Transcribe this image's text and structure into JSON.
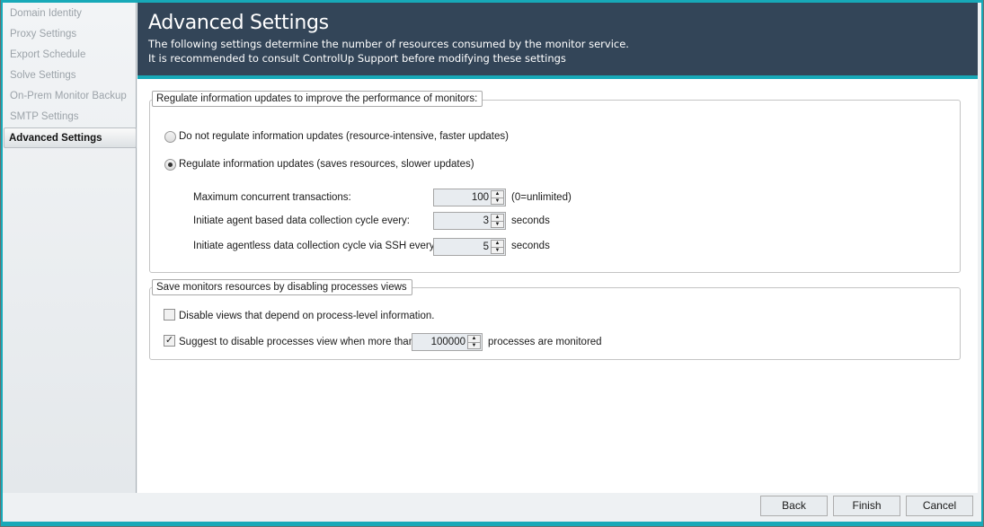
{
  "sidebar": {
    "items": [
      {
        "label": "Domain Identity"
      },
      {
        "label": "Proxy Settings"
      },
      {
        "label": "Export Schedule"
      },
      {
        "label": "Solve Settings"
      },
      {
        "label": "On-Prem Monitor Backup"
      },
      {
        "label": "SMTP Settings"
      },
      {
        "label": "Advanced Settings",
        "active": true
      }
    ]
  },
  "header": {
    "title": "Advanced Settings",
    "line1": "The following settings determine the number of resources consumed by the monitor service.",
    "line2": "It is recommended to consult ControlUp Support before modifying these settings"
  },
  "regulate": {
    "legend": "Regulate information updates to improve the performance of monitors:",
    "option_off": "Do not regulate information updates (resource-intensive, faster updates)",
    "option_on": "Regulate information updates (saves resources, slower updates)",
    "selected": "option_on",
    "max_label": "Maximum concurrent transactions:",
    "max_value": "100",
    "max_suffix": "(0=unlimited)",
    "agent_label": "Initiate agent based data collection cycle every:",
    "agent_value": "3",
    "agent_suffix": "seconds",
    "ssh_label": "Initiate agentless data collection cycle via SSH every:",
    "ssh_value": "5",
    "ssh_suffix": "seconds"
  },
  "processes": {
    "legend": "Save monitors resources by disabling processes views",
    "disable_label": "Disable views that depend on process-level information.",
    "disable_checked": false,
    "suggest_label": "Suggest to disable processes view when more than",
    "suggest_checked": true,
    "suggest_value": "100000",
    "suggest_suffix": "processes are monitored"
  },
  "footer": {
    "back": "Back",
    "finish": "Finish",
    "cancel": "Cancel"
  },
  "colors": {
    "accent": "#17a9b8",
    "header_bg": "#334558"
  }
}
